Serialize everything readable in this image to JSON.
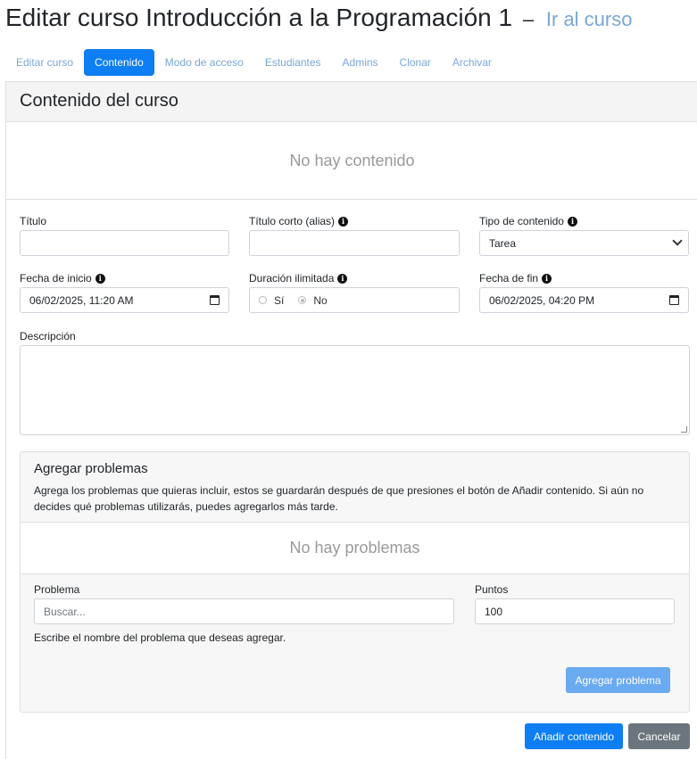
{
  "header": {
    "title": "Editar curso Introducción a la Programación 1",
    "separator": "–",
    "course_link": "Ir al curso"
  },
  "tabs": [
    {
      "label": "Editar curso",
      "active": false
    },
    {
      "label": "Contenido",
      "active": true
    },
    {
      "label": "Modo de acceso",
      "active": false
    },
    {
      "label": "Estudiantes",
      "active": false
    },
    {
      "label": "Admins",
      "active": false
    },
    {
      "label": "Clonar",
      "active": false
    },
    {
      "label": "Archivar",
      "active": false
    }
  ],
  "content": {
    "heading": "Contenido del curso",
    "empty_message": "No hay contenido"
  },
  "form": {
    "title_label": "Título",
    "title_value": "",
    "alias_label": "Título corto (alias)",
    "alias_value": "",
    "type_label": "Tipo de contenido",
    "type_selected": "Tarea",
    "start_label": "Fecha de inicio",
    "start_value": "06/02/2025, 11:20 AM",
    "unlimited_label": "Duración ilimitada",
    "unlimited_yes": "Sí",
    "unlimited_no": "No",
    "unlimited_selected": "No",
    "end_label": "Fecha de fin",
    "end_value": "06/02/2025, 04:20 PM",
    "description_label": "Descripción",
    "description_value": ""
  },
  "problems": {
    "title": "Agregar problemas",
    "description": "Agrega los problemas que quieras incluir, estos se guardarán después de que presiones el botón de Añadir contenido. Si aún no decides qué problemas utilizarás, puedes agregarlos más tarde.",
    "empty_message": "No hay problemas",
    "problem_label": "Problema",
    "problem_placeholder": "Buscar...",
    "points_label": "Puntos",
    "points_value": "100",
    "help_text": "Escribe el nombre del problema que deseas agregar.",
    "add_button": "Agregar problema"
  },
  "actions": {
    "submit": "Añadir contenido",
    "cancel": "Cancelar"
  },
  "icons": {
    "info": "info-icon",
    "calendar": "calendar-icon",
    "dropdown": "chevron-down-icon"
  },
  "colors": {
    "primary": "#0d7ef3",
    "primary_light": "#6aaaf0",
    "secondary": "#6c757d",
    "link": "#7aa7d6"
  }
}
